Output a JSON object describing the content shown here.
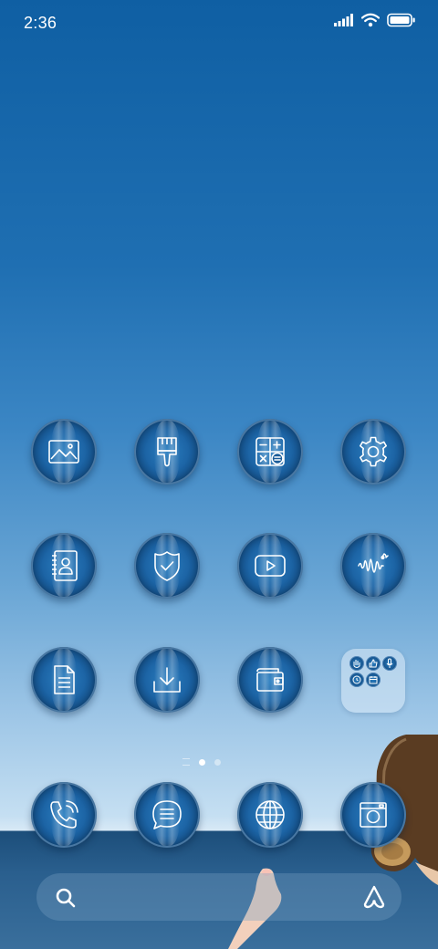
{
  "status_bar": {
    "time": "2:36",
    "icons": [
      "signal-icon",
      "wifi-icon",
      "battery-icon"
    ]
  },
  "apps": [
    {
      "name": "gallery",
      "icon": "image-icon"
    },
    {
      "name": "theme",
      "icon": "paintbrush-icon"
    },
    {
      "name": "calculator",
      "icon": "calculator-icon"
    },
    {
      "name": "settings",
      "icon": "gear-icon"
    },
    {
      "name": "contacts",
      "icon": "contacts-book-icon"
    },
    {
      "name": "security",
      "icon": "shield-check-icon"
    },
    {
      "name": "video",
      "icon": "play-icon"
    },
    {
      "name": "music",
      "icon": "soundwave-icon"
    },
    {
      "name": "notes",
      "icon": "document-icon"
    },
    {
      "name": "downloads",
      "icon": "download-icon"
    },
    {
      "name": "wallet",
      "icon": "wallet-icon"
    }
  ],
  "folder": {
    "mini_icons": [
      "hand-icon",
      "thumbs-up-icon",
      "microphone-icon",
      "clock-icon",
      "calendar-icon"
    ]
  },
  "page_indicator": {
    "pages": 2,
    "current": 1
  },
  "dock": [
    {
      "name": "phone",
      "icon": "phone-icon"
    },
    {
      "name": "messages",
      "icon": "message-icon"
    },
    {
      "name": "browser",
      "icon": "globe-icon"
    },
    {
      "name": "camera",
      "icon": "camera-icon"
    }
  ],
  "search": {
    "left_icon": "search-icon",
    "right_icon": "assistant-icon"
  }
}
